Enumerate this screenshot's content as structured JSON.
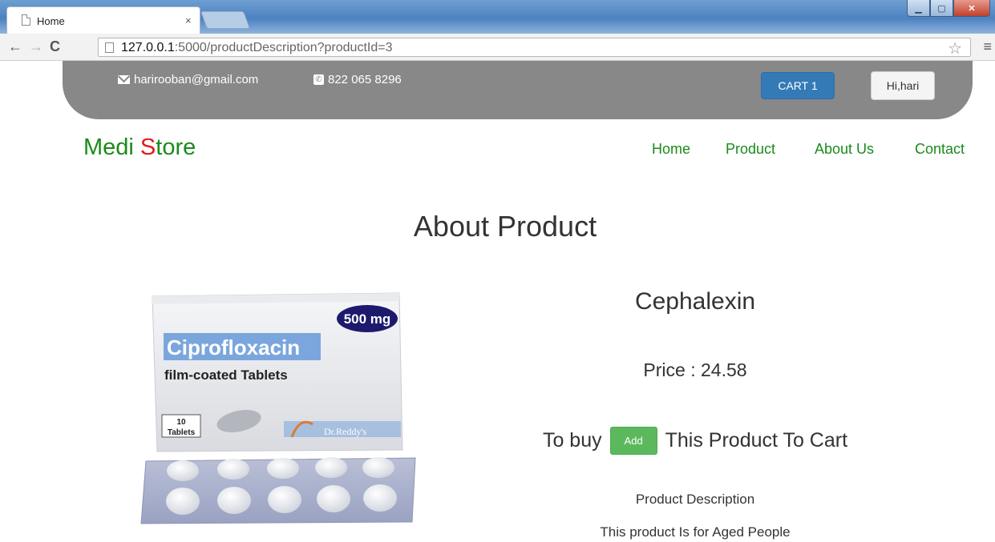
{
  "browser": {
    "tab_title": "Home",
    "tab_close": "×",
    "url_host": "127.0.0.1",
    "url_rest": ":5000/productDescription?productId=3"
  },
  "topbar": {
    "email": "harirooban@gmail.com",
    "phone": "822 065 8296",
    "cart_label": "CART 1",
    "user_label": "Hi,hari"
  },
  "brand": {
    "part1": "Medi ",
    "s": "S",
    "part2": "tore"
  },
  "nav": [
    "Home",
    "Product",
    "About Us",
    "Contact"
  ],
  "page": {
    "title": "About Product"
  },
  "product": {
    "name": "Cephalexin",
    "price_text": "Price : 24.58",
    "buy_prefix": "To buy",
    "add_label": "Add",
    "buy_suffix": "This Product To Cart",
    "desc_heading": "Product Description",
    "desc_text": "This product Is for Aged People",
    "image": {
      "strength": "500 mg",
      "drug": "Ciprofloxacin",
      "form": "film-coated Tablets",
      "count_num": "10",
      "count_label": "Tablets",
      "maker": "Dr.Reddy's",
      "accent": "#7aa6dd",
      "badge": "#1d1a6e"
    }
  }
}
